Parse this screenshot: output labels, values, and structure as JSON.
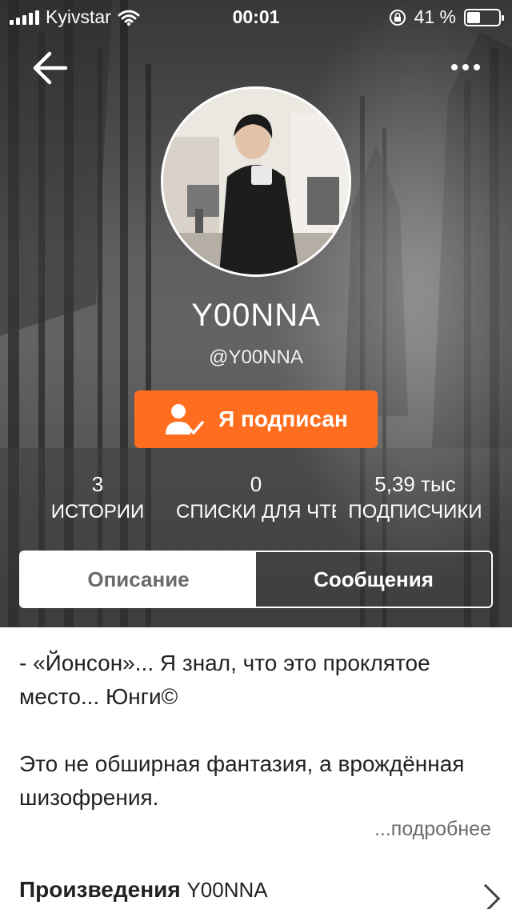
{
  "status_bar": {
    "carrier": "Kyivstar",
    "time": "00:01",
    "battery_percent_text": "41 %",
    "battery_level": 0.41
  },
  "profile": {
    "display_name": "Y00NNA",
    "handle": "@Y00NNA",
    "follow_label": "Я подписан"
  },
  "stats": [
    {
      "value": "3",
      "label": "ИСТОРИИ"
    },
    {
      "value": "0",
      "label": "СПИСКИ ДЛЯ ЧТЕ"
    },
    {
      "value": "5,39 тыс",
      "label": "ПОДПИСЧИКИ"
    }
  ],
  "tabs": [
    {
      "label": "Описание",
      "active": false
    },
    {
      "label": "Сообщения",
      "active": true
    }
  ],
  "description": {
    "paragraphs": [
      "- «Йонсон»... Я знал, что это проклятое место... Юнги©",
      "Это не обширная фантазия, а врождённая шизофрения."
    ],
    "more_label": "...подробнее"
  },
  "works": {
    "title": "Произведения",
    "author": "Y00NNA"
  },
  "colors": {
    "accent": "#ff6e1f"
  },
  "icons": {
    "back": "arrow-left-icon",
    "more": "more-dots-icon",
    "wifi": "wifi-icon",
    "lock_rotation": "rotation-lock-icon",
    "follow": "user-check-icon",
    "chevron": "chevron-right-icon"
  }
}
